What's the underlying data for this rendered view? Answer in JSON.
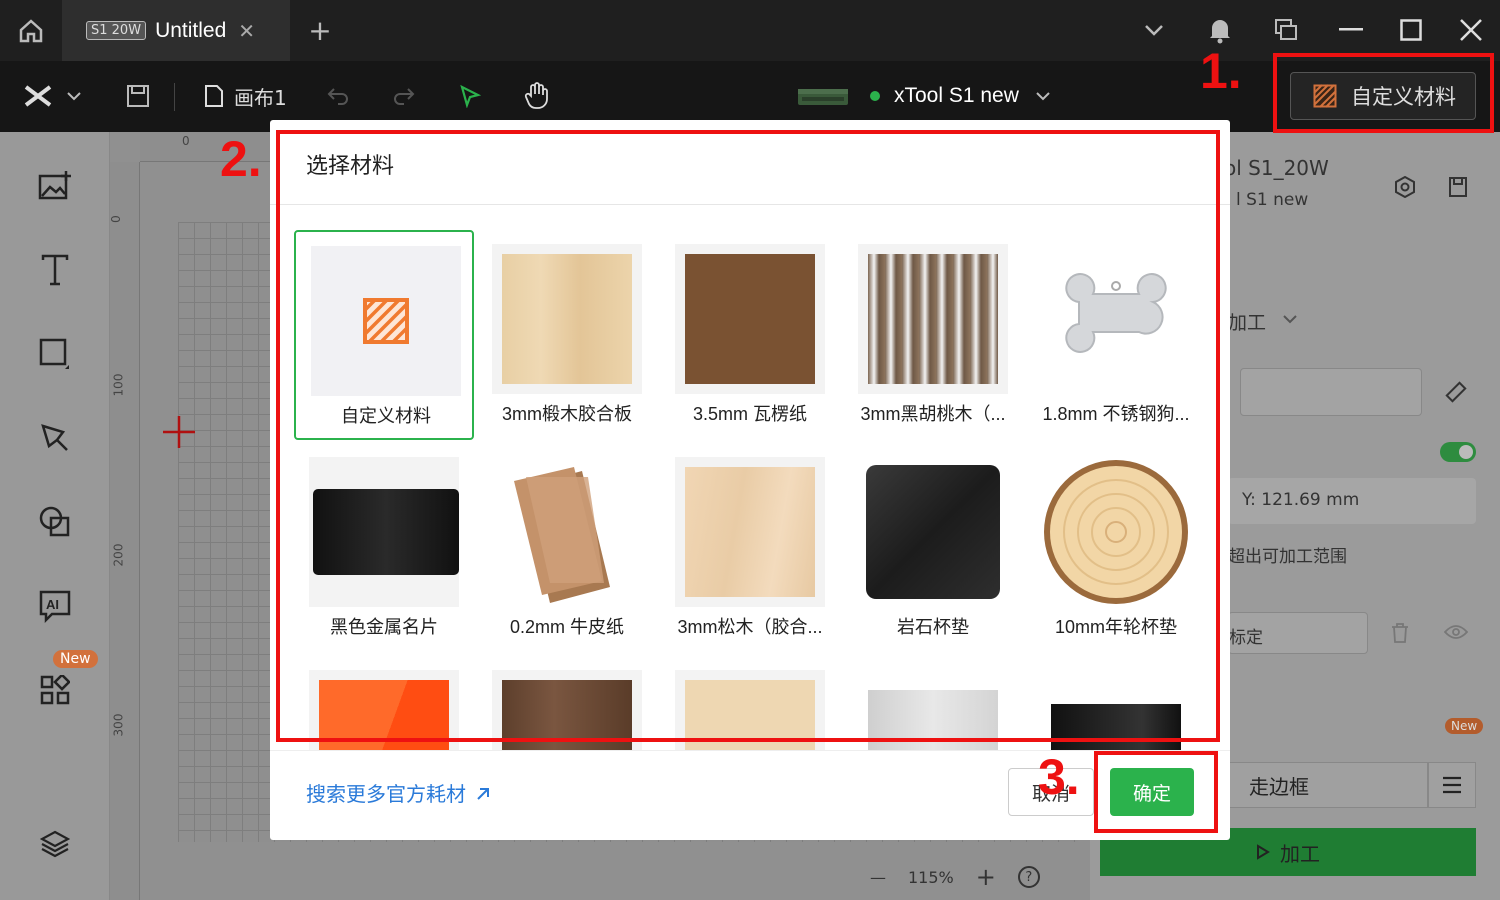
{
  "titlebar": {
    "tab_badge": "S1 20W",
    "tab_title": "Untitled",
    "tab_close": "✕",
    "tab_add": "+"
  },
  "toolbar": {
    "canvas_name": "画布1",
    "device_name": "xTool S1 new",
    "custom_material_label": "自定义材料"
  },
  "sidebar": {
    "new_badge": "New"
  },
  "ruler": {
    "top_zero": "0",
    "left": [
      "0",
      "100",
      "200",
      "300"
    ]
  },
  "zoom": {
    "minus": "—",
    "value": "115%",
    "plus": "+",
    "help": "?"
  },
  "right_panel": {
    "device_title": "ol S1_20W",
    "device_sub": "l S1 new",
    "process_label": "加工",
    "y_value": "Y: 121.69 mm",
    "out_of_range": "超出可加工范围",
    "calibrate_label": "标定",
    "new_badge": "New",
    "frame_label": "走边框",
    "run_label": "加工"
  },
  "modal": {
    "title": "选择材料",
    "items": [
      {
        "name": "自定义材料"
      },
      {
        "name": "3mm椴木胶合板"
      },
      {
        "name": "3.5mm 瓦楞纸"
      },
      {
        "name": "3mm黑胡桃木（..."
      },
      {
        "name": "1.8mm 不锈钢狗..."
      },
      {
        "name": "黑色金属名片"
      },
      {
        "name": "0.2mm 牛皮纸"
      },
      {
        "name": "3mm松木（胶合..."
      },
      {
        "name": "岩石杯垫"
      },
      {
        "name": "10mm年轮杯垫"
      },
      {
        "name": ""
      },
      {
        "name": ""
      },
      {
        "name": ""
      },
      {
        "name": ""
      },
      {
        "name": ""
      }
    ],
    "more_link": "搜索更多官方耗材",
    "cancel_label": "取消",
    "ok_label": "确定"
  },
  "annotations": {
    "step1": "1.",
    "step2": "2.",
    "step3": "3."
  },
  "colors": {
    "accent_green": "#2bb24c",
    "annotation_red": "#ee1111",
    "link_blue": "#2a7ad9"
  }
}
